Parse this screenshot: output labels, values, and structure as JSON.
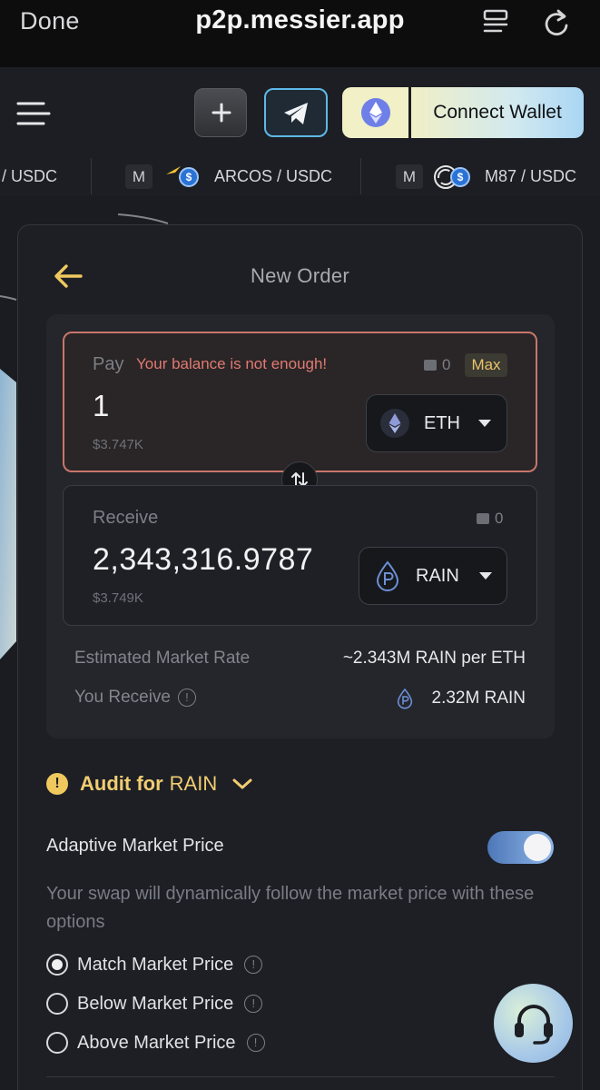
{
  "browser": {
    "done_label": "Done",
    "url": "p2p.messier.app"
  },
  "header": {
    "plus_label": "+",
    "connect_wallet_label": "Connect Wallet"
  },
  "ticker": {
    "items": [
      {
        "pair": "/ USDC"
      },
      {
        "badge": "M",
        "pair": "ARCOS / USDC",
        "coin": "$"
      },
      {
        "badge": "M",
        "pair": "M87 / USDC",
        "coin": "$"
      }
    ]
  },
  "order": {
    "title": "New Order",
    "pay": {
      "label": "Pay",
      "error": "Your balance is not enough!",
      "balance": "0",
      "max_label": "Max",
      "amount": "1",
      "usd": "$3.747K",
      "token": "ETH"
    },
    "receive": {
      "label": "Receive",
      "balance": "0",
      "amount": "2,343,316.9787",
      "usd": "$3.749K",
      "token": "RAIN"
    },
    "rate": {
      "label": "Estimated Market Rate",
      "value": "~2.343M RAIN per ETH"
    },
    "you_receive": {
      "label": "You Receive",
      "info": "!",
      "value": "2.32M RAIN"
    }
  },
  "audit": {
    "icon": "!",
    "label": "Audit for",
    "token": "RAIN"
  },
  "adaptive": {
    "label": "Adaptive Market Price",
    "enabled": true,
    "description": "Your swap will dynamically follow the market price with these options"
  },
  "price_options": [
    {
      "label": "Match Market Price",
      "selected": true,
      "info": "!"
    },
    {
      "label": "Below Market Price",
      "selected": false,
      "info": "!"
    },
    {
      "label": "Above Market Price",
      "selected": false,
      "info": "!"
    }
  ],
  "colors": {
    "accent_yellow": "#f1cd71",
    "error_red": "#e07a72",
    "error_border": "#c7766a",
    "telegram_blue": "#5fb8e6"
  }
}
